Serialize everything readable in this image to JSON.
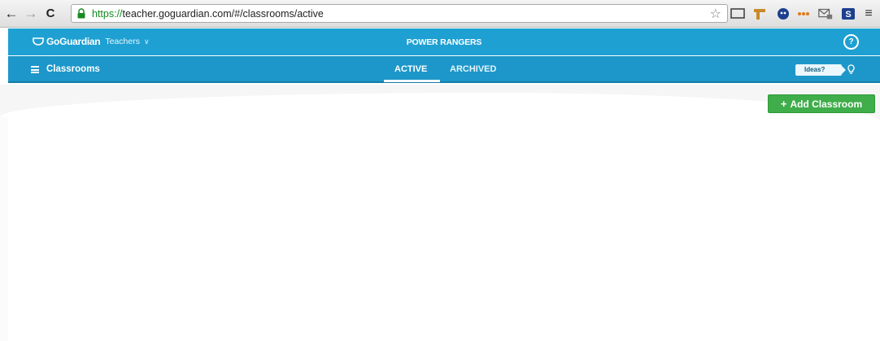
{
  "browser": {
    "url_scheme": "https://",
    "url_rest": "teacher.goguardian.com/#/classrooms/active",
    "menu_glyph": "≡"
  },
  "header": {
    "brand_name": "GoGuardian",
    "brand_product": "Teachers",
    "org_name": "POWER RANGERS"
  },
  "sub_nav": {
    "section_title": "Classrooms",
    "tabs": [
      {
        "label": "ACTIVE"
      },
      {
        "label": "ARCHIVED"
      }
    ],
    "ideas_label": "Ideas?"
  },
  "main": {
    "add_button_label": "Add Classroom"
  },
  "colors": {
    "header_blue": "#1fa0d2",
    "subnav_blue": "#1d97c9",
    "add_green": "#3fad4a"
  }
}
